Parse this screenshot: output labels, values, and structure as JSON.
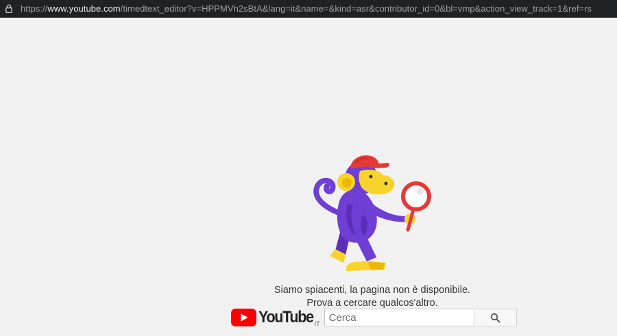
{
  "browser": {
    "url_scheme": "https://",
    "url_host": "www.youtube.com",
    "url_rest": "/timedtext_editor?v=HPPMVh2sBtA&lang=it&name=&kind=asr&contributor_id=0&bl=vmp&action_view_track=1&ref=rs",
    "lock_icon": "lock-icon"
  },
  "error": {
    "illustration": "monkey-with-magnifying-glass",
    "line1": "Siamo spiacenti, la pagina non è disponibile.",
    "line2": "Prova a cercare qualcos'altro."
  },
  "search": {
    "logo_text": "YouTube",
    "country_code": "IT",
    "placeholder": "Cerca",
    "button_icon": "search-icon"
  },
  "colors": {
    "background": "#f1f1f1",
    "youtube_red": "#ff0000",
    "monkey_purple": "#6f3ed4",
    "monkey_yellow": "#f8d32b",
    "hat_red": "#e53935"
  }
}
